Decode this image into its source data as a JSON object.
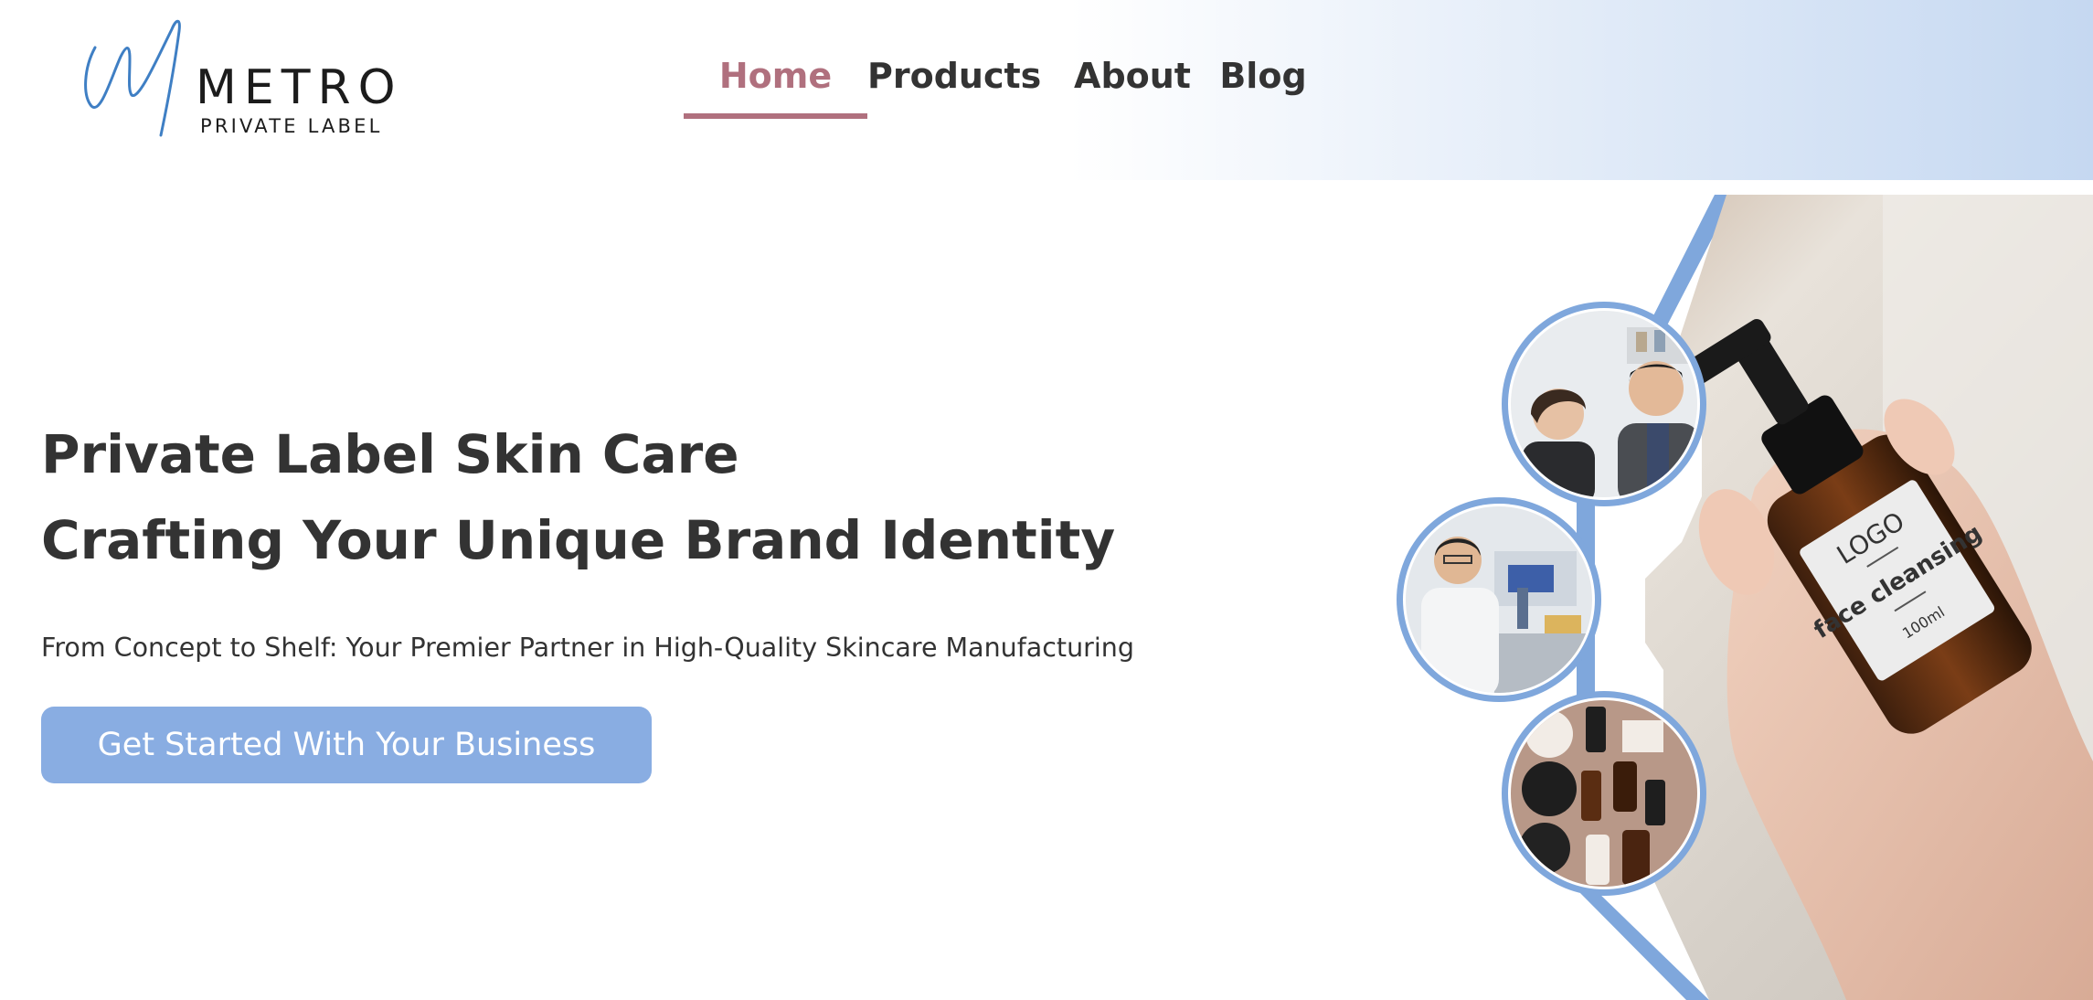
{
  "brand": {
    "name": "METRO",
    "tagline": "PRIVATE LABEL",
    "accent_color": "#3f7fc4"
  },
  "nav": {
    "items": [
      {
        "label": "Home",
        "active": true
      },
      {
        "label": "Products",
        "active": false
      },
      {
        "label": "About",
        "active": false
      },
      {
        "label": "Blog",
        "active": false
      }
    ],
    "active_color": "#b0707e"
  },
  "hero": {
    "heading_line1": "Private Label Skin Care",
    "heading_line2": "Crafting Your Unique Brand Identity",
    "subtitle": "From Concept to Shelf: Your Premier Partner in High-Quality Skincare Manufacturing",
    "cta_label": "Get Started With Your Business",
    "cta_color": "#89ade2"
  },
  "imagery": {
    "bottle_label_logo": "LOGO",
    "bottle_label_product": "face cleansing",
    "bottle_label_volume": "100ml",
    "circle_photos": [
      "consultation-photo",
      "laboratory-photo",
      "product-lineup-photo"
    ],
    "frame_color": "#7fa7dc"
  }
}
